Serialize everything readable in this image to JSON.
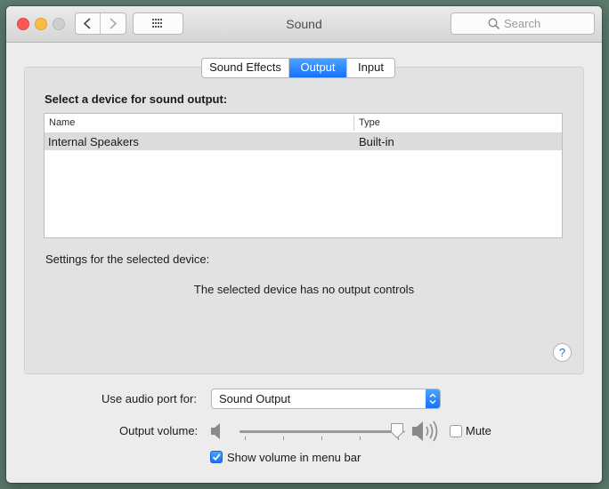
{
  "window": {
    "title": "Sound",
    "search_placeholder": "Search"
  },
  "tabs": [
    {
      "label": "Sound Effects",
      "active": false
    },
    {
      "label": "Output",
      "active": true
    },
    {
      "label": "Input",
      "active": false
    }
  ],
  "output": {
    "heading": "Select a device for sound output:",
    "columns": {
      "name": "Name",
      "type": "Type"
    },
    "devices": [
      {
        "name": "Internal Speakers",
        "type": "Built-in",
        "selected": true
      }
    ],
    "settings_label": "Settings for the selected device:",
    "no_controls_text": "The selected device has no output controls",
    "help_label": "?"
  },
  "bottom": {
    "audio_port_label": "Use audio port for:",
    "audio_port_value": "Sound Output",
    "volume_label": "Output volume:",
    "volume_fraction": 0.95,
    "mute_label": "Mute",
    "mute_checked": false,
    "show_volume_label": "Show volume in menu bar",
    "show_volume_checked": true
  },
  "colors": {
    "accent": "#1571fb",
    "close": "#fc5753",
    "minimize": "#fdbc40"
  }
}
